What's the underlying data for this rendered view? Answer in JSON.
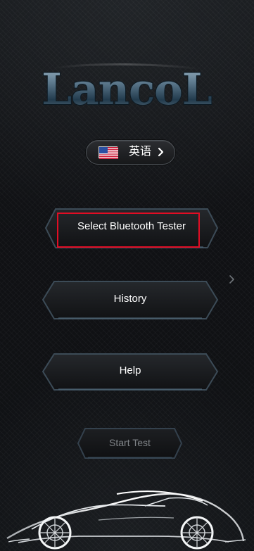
{
  "header": {
    "logo_text": "LancoL"
  },
  "language": {
    "label": "英语",
    "flag": "us-flag-icon",
    "chevron": "chevron-right-icon"
  },
  "menu": {
    "select_bluetooth_tester_label": "Select Bluetooth Tester",
    "history_label": "History",
    "help_label": "Help",
    "start_test_label": "Start Test"
  },
  "side": {
    "icon": "chevron-right-icon"
  },
  "decor": {
    "car_icon": "car-outline-icon"
  },
  "colors": {
    "highlight_outline": "#e10d24",
    "button_border": "#3c4b57",
    "active_text": "#ffffff",
    "disabled_text": "#7f8387"
  }
}
